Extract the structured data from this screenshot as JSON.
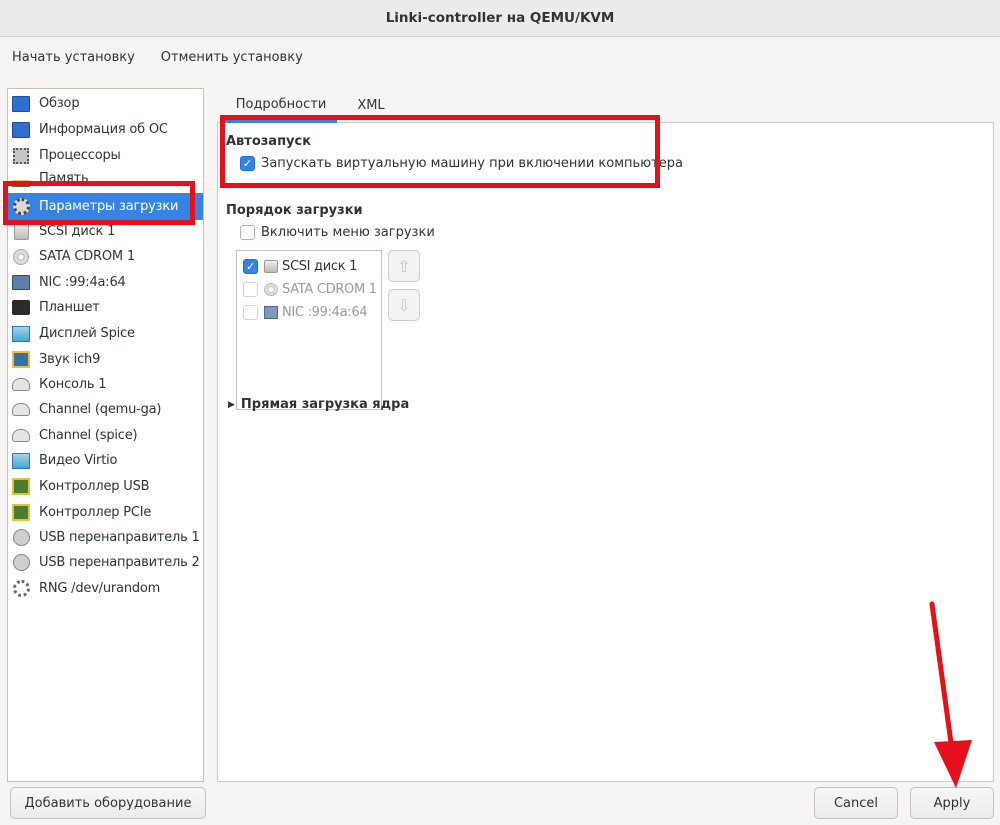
{
  "window": {
    "title": "Linki-controller на QEMU/KVM"
  },
  "menubar": {
    "begin_install": "Начать установку",
    "cancel_install": "Отменить установку"
  },
  "sidebar": {
    "items": [
      {
        "label": "Обзор",
        "icon": "monitor-icon"
      },
      {
        "label": "Информация об ОС",
        "icon": "monitor-icon"
      },
      {
        "label": "Процессоры",
        "icon": "cpu-icon"
      },
      {
        "label": "Память",
        "icon": "memory-icon"
      },
      {
        "label": "Параметры загрузки",
        "icon": "gear-icon"
      },
      {
        "label": "SCSI диск 1",
        "icon": "disk-icon"
      },
      {
        "label": "SATA CDROM 1",
        "icon": "cdrom-icon"
      },
      {
        "label": "NIC :99:4a:64",
        "icon": "network-icon"
      },
      {
        "label": "Планшет",
        "icon": "tablet-icon"
      },
      {
        "label": "Дисплей Spice",
        "icon": "display-icon"
      },
      {
        "label": "Звук ich9",
        "icon": "sound-icon"
      },
      {
        "label": "Консоль 1",
        "icon": "console-icon"
      },
      {
        "label": "Channel (qemu-ga)",
        "icon": "console-icon"
      },
      {
        "label": "Channel (spice)",
        "icon": "console-icon"
      },
      {
        "label": "Видео Virtio",
        "icon": "video-icon"
      },
      {
        "label": "Контроллер USB",
        "icon": "pci-icon"
      },
      {
        "label": "Контроллер PCIe",
        "icon": "pci-icon"
      },
      {
        "label": "USB перенаправитель 1",
        "icon": "usb-icon"
      },
      {
        "label": "USB перенаправитель 2",
        "icon": "usb-icon"
      },
      {
        "label": "RNG /dev/urandom",
        "icon": "rng-icon"
      }
    ],
    "selected": "Параметры загрузки"
  },
  "tabs": {
    "details": "Подробности",
    "xml": "XML"
  },
  "autostart": {
    "heading": "Автозапуск",
    "checkbox_label": "Запускать виртуальную машину при включении компьютера",
    "checked": true
  },
  "boot_order": {
    "heading": "Порядок загрузки",
    "enable_menu_label": "Включить меню загрузки",
    "enable_menu_checked": false,
    "devices": [
      {
        "label": "SCSI диск 1",
        "checked": true,
        "icon": "disk-icon"
      },
      {
        "label": "SATA CDROM 1",
        "checked": false,
        "icon": "cdrom-icon"
      },
      {
        "label": "NIC :99:4a:64",
        "checked": false,
        "icon": "network-icon"
      }
    ],
    "move_up_icon": "arrow-up-icon",
    "move_down_icon": "arrow-down-icon"
  },
  "direct_kernel": {
    "label": "Прямая загрузка ядра",
    "expanded": false
  },
  "footer": {
    "add_hardware": "Добавить оборудование",
    "cancel": "Cancel",
    "apply": "Apply"
  },
  "colors": {
    "accent": "#3584e4",
    "annotation_red": "#e4101a"
  }
}
